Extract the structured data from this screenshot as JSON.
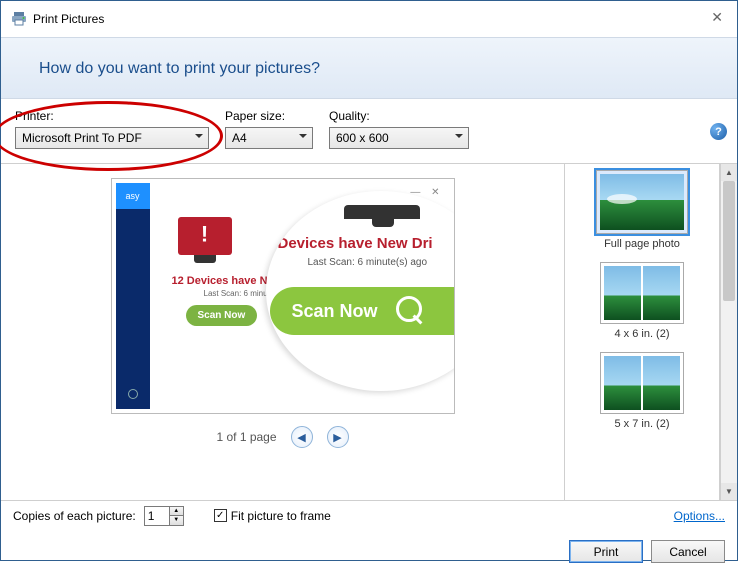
{
  "window": {
    "title": "Print Pictures"
  },
  "heading": "How do you want to print your pictures?",
  "fields": {
    "printer": {
      "label": "Printer:",
      "value": "Microsoft Print To PDF"
    },
    "paper": {
      "label": "Paper size:",
      "value": "A4"
    },
    "quality": {
      "label": "Quality:",
      "value": "600 x 600"
    }
  },
  "preview": {
    "left_badge": "asy",
    "small_headline": "12 Devices have N",
    "small_sub": "Last Scan: 6 minute",
    "small_button": "Scan Now",
    "lens_headline": "Devices have New Dri",
    "lens_sub": "Last Scan: 6 minute(s) ago",
    "lens_button": "Scan Now",
    "page_label": "1 of 1 page"
  },
  "layouts": [
    {
      "name": "full-page-photo",
      "label": "Full page photo",
      "selected": true,
      "type": "full"
    },
    {
      "name": "4x6-2",
      "label": "4 x 6 in. (2)",
      "selected": false,
      "type": "grid2"
    },
    {
      "name": "5x7-2",
      "label": "5 x 7 in. (2)",
      "selected": false,
      "type": "grid2"
    }
  ],
  "bottom": {
    "copies_label": "Copies of each picture:",
    "copies_value": "1",
    "fit_label": "Fit picture to frame",
    "fit_checked": true,
    "options_link": "Options..."
  },
  "buttons": {
    "print": "Print",
    "cancel": "Cancel"
  },
  "help_glyph": "?"
}
